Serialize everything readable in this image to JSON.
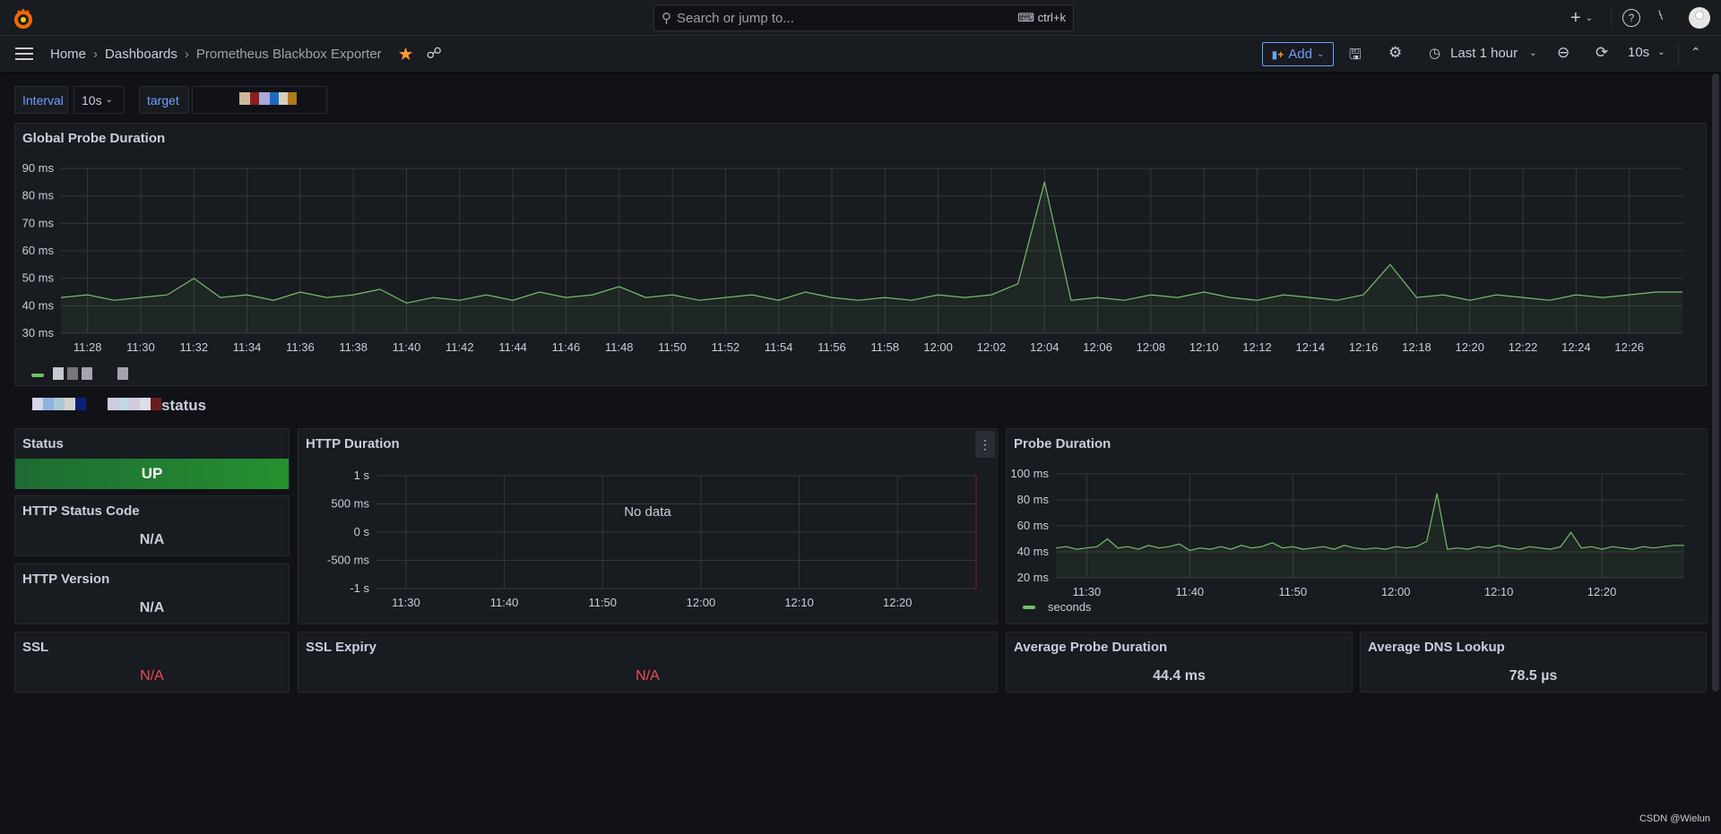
{
  "topbar": {
    "search_placeholder": "Search or jump to...",
    "search_shortcut": "ctrl+k",
    "icons": [
      "grafana-logo",
      "search-icon",
      "keyboard-icon",
      "plus-icon",
      "chevron-down-icon",
      "help-icon",
      "rss-icon",
      "avatar"
    ]
  },
  "navbar": {
    "breadcrumb": [
      "Home",
      "Dashboards",
      "Prometheus Blackbox Exporter"
    ],
    "add_label": "Add",
    "time_range": "Last 1 hour",
    "refresh_interval": "10s",
    "accent": "#6e9fff",
    "star_color": "#ff9830"
  },
  "variables": {
    "interval_label": "Interval",
    "interval_value": "10s",
    "target_label": "target"
  },
  "global_panel": {
    "title": "Global Probe Duration"
  },
  "row": {
    "title_suffix": "status"
  },
  "status_panel": {
    "title": "Status",
    "value": "UP",
    "color": "#299c46"
  },
  "http_status_panel": {
    "title": "HTTP Status Code",
    "value": "N/A"
  },
  "http_version_panel": {
    "title": "HTTP Version",
    "value": "N/A"
  },
  "ssl_panel": {
    "title": "SSL",
    "value": "N/A",
    "color": "#f2495c"
  },
  "ssl_expiry_panel": {
    "title": "SSL Expiry",
    "value": "N/A",
    "color": "#f2495c"
  },
  "http_duration_panel": {
    "title": "HTTP Duration",
    "no_data": "No data"
  },
  "probe_panel": {
    "title": "Probe Duration",
    "legend": "seconds"
  },
  "avg_probe_panel": {
    "title": "Average Probe Duration",
    "value": "44.4 ms"
  },
  "avg_dns_panel": {
    "title": "Average DNS Lookup",
    "value": "78.5 µs"
  },
  "watermark": "CSDN @Wielun",
  "chart_data": [
    {
      "type": "line",
      "title": "Global Probe Duration",
      "color": "#73bf69",
      "ylim": [
        30,
        90
      ],
      "yticks": [
        "30 ms",
        "40 ms",
        "50 ms",
        "60 ms",
        "70 ms",
        "80 ms",
        "90 ms"
      ],
      "yvals": [
        30,
        40,
        50,
        60,
        70,
        80,
        90
      ],
      "xlim": [
        "11:27",
        "12:28"
      ],
      "xticks": [
        "11:28",
        "11:30",
        "11:32",
        "11:34",
        "11:36",
        "11:38",
        "11:40",
        "11:42",
        "11:44",
        "11:46",
        "11:48",
        "11:50",
        "11:52",
        "11:54",
        "11:56",
        "11:58",
        "12:00",
        "12:02",
        "12:04",
        "12:06",
        "12:08",
        "12:10",
        "12:12",
        "12:14",
        "12:16",
        "12:18",
        "12:20",
        "12:22",
        "12:24",
        "12:26"
      ],
      "x": [
        "11:27",
        "11:28",
        "11:29",
        "11:30",
        "11:31",
        "11:32",
        "11:33",
        "11:34",
        "11:35",
        "11:36",
        "11:37",
        "11:38",
        "11:39",
        "11:40",
        "11:41",
        "11:42",
        "11:43",
        "11:44",
        "11:45",
        "11:46",
        "11:47",
        "11:48",
        "11:49",
        "11:50",
        "11:51",
        "11:52",
        "11:53",
        "11:54",
        "11:55",
        "11:56",
        "11:57",
        "11:58",
        "11:59",
        "12:00",
        "12:01",
        "12:02",
        "12:03",
        "12:04",
        "12:05",
        "12:06",
        "12:07",
        "12:08",
        "12:09",
        "12:10",
        "12:11",
        "12:12",
        "12:13",
        "12:14",
        "12:15",
        "12:16",
        "12:17",
        "12:18",
        "12:19",
        "12:20",
        "12:21",
        "12:22",
        "12:23",
        "12:24",
        "12:25",
        "12:26",
        "12:27",
        "12:28"
      ],
      "y": [
        43,
        44,
        42,
        43,
        44,
        50,
        43,
        44,
        42,
        45,
        43,
        44,
        46,
        41,
        43,
        42,
        44,
        42,
        45,
        43,
        44,
        47,
        43,
        44,
        42,
        43,
        44,
        42,
        45,
        43,
        42,
        43,
        42,
        44,
        43,
        44,
        48,
        85,
        42,
        43,
        42,
        44,
        43,
        45,
        43,
        42,
        44,
        43,
        42,
        44,
        55,
        43,
        44,
        42,
        44,
        43,
        42,
        44,
        43,
        44,
        45,
        45
      ]
    },
    {
      "type": "line",
      "title": "HTTP Duration",
      "ylim": [
        -1000,
        1000
      ],
      "yticks": [
        "-1 s",
        "-500 ms",
        "0 s",
        "500 ms",
        "1 s"
      ],
      "yvals": [
        -1000,
        -500,
        0,
        500,
        1000
      ],
      "xlim": [
        "11:27",
        "12:28"
      ],
      "xticks": [
        "11:30",
        "11:40",
        "11:50",
        "12:00",
        "12:10",
        "12:20"
      ],
      "x": [],
      "y": []
    },
    {
      "type": "line",
      "title": "Probe Duration",
      "color": "#73bf69",
      "legend": [
        "seconds"
      ],
      "ylim": [
        20,
        100
      ],
      "yticks": [
        "20 ms",
        "40 ms",
        "60 ms",
        "80 ms",
        "100 ms"
      ],
      "yvals": [
        20,
        40,
        60,
        80,
        100
      ],
      "xlim": [
        "11:27",
        "12:28"
      ],
      "xticks": [
        "11:30",
        "11:40",
        "11:50",
        "12:00",
        "12:10",
        "12:20"
      ]
    }
  ]
}
